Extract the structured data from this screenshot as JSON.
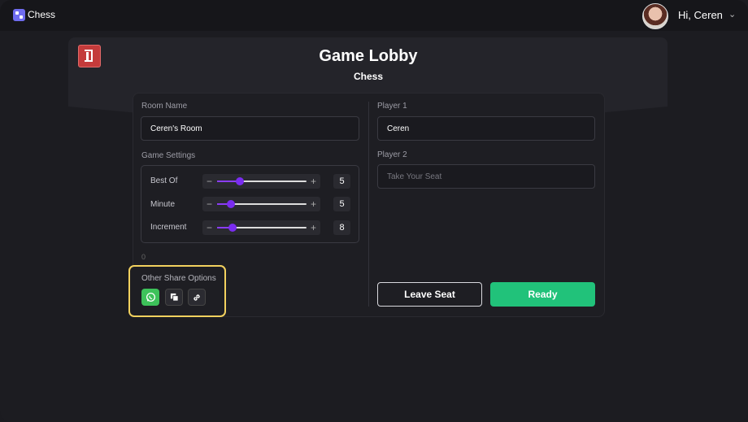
{
  "topbar": {
    "app_title": "Chess",
    "greeting": "Hi, Ceren"
  },
  "header": {
    "title": "Game Lobby",
    "subtitle": "Chess"
  },
  "left": {
    "room_name_label": "Room Name",
    "room_name_value": "Ceren's Room",
    "game_settings_label": "Game Settings",
    "settings": [
      {
        "label": "Best Of",
        "value": "5",
        "level": 0.25
      },
      {
        "label": "Minute",
        "value": "5",
        "level": 0.15
      },
      {
        "label": "Increment",
        "value": "8",
        "level": 0.17
      }
    ],
    "stray_text": "0",
    "share_label": "Other Share Options"
  },
  "right": {
    "player1_label": "Player 1",
    "player1_value": "Ceren",
    "player2_label": "Player 2",
    "player2_placeholder": "Take Your Seat",
    "leave_label": "Leave Seat",
    "ready_label": "Ready"
  },
  "colors": {
    "accent": "#21c27a",
    "slider": "#7a2cf0",
    "highlight": "#f2d15e",
    "exit": "#c43b3b"
  },
  "icons": [
    "chess-logo-icon",
    "exit-door-icon",
    "chevron-down-icon",
    "whatsapp-icon",
    "copy-icon",
    "link-icon",
    "minus-icon",
    "plus-icon"
  ]
}
